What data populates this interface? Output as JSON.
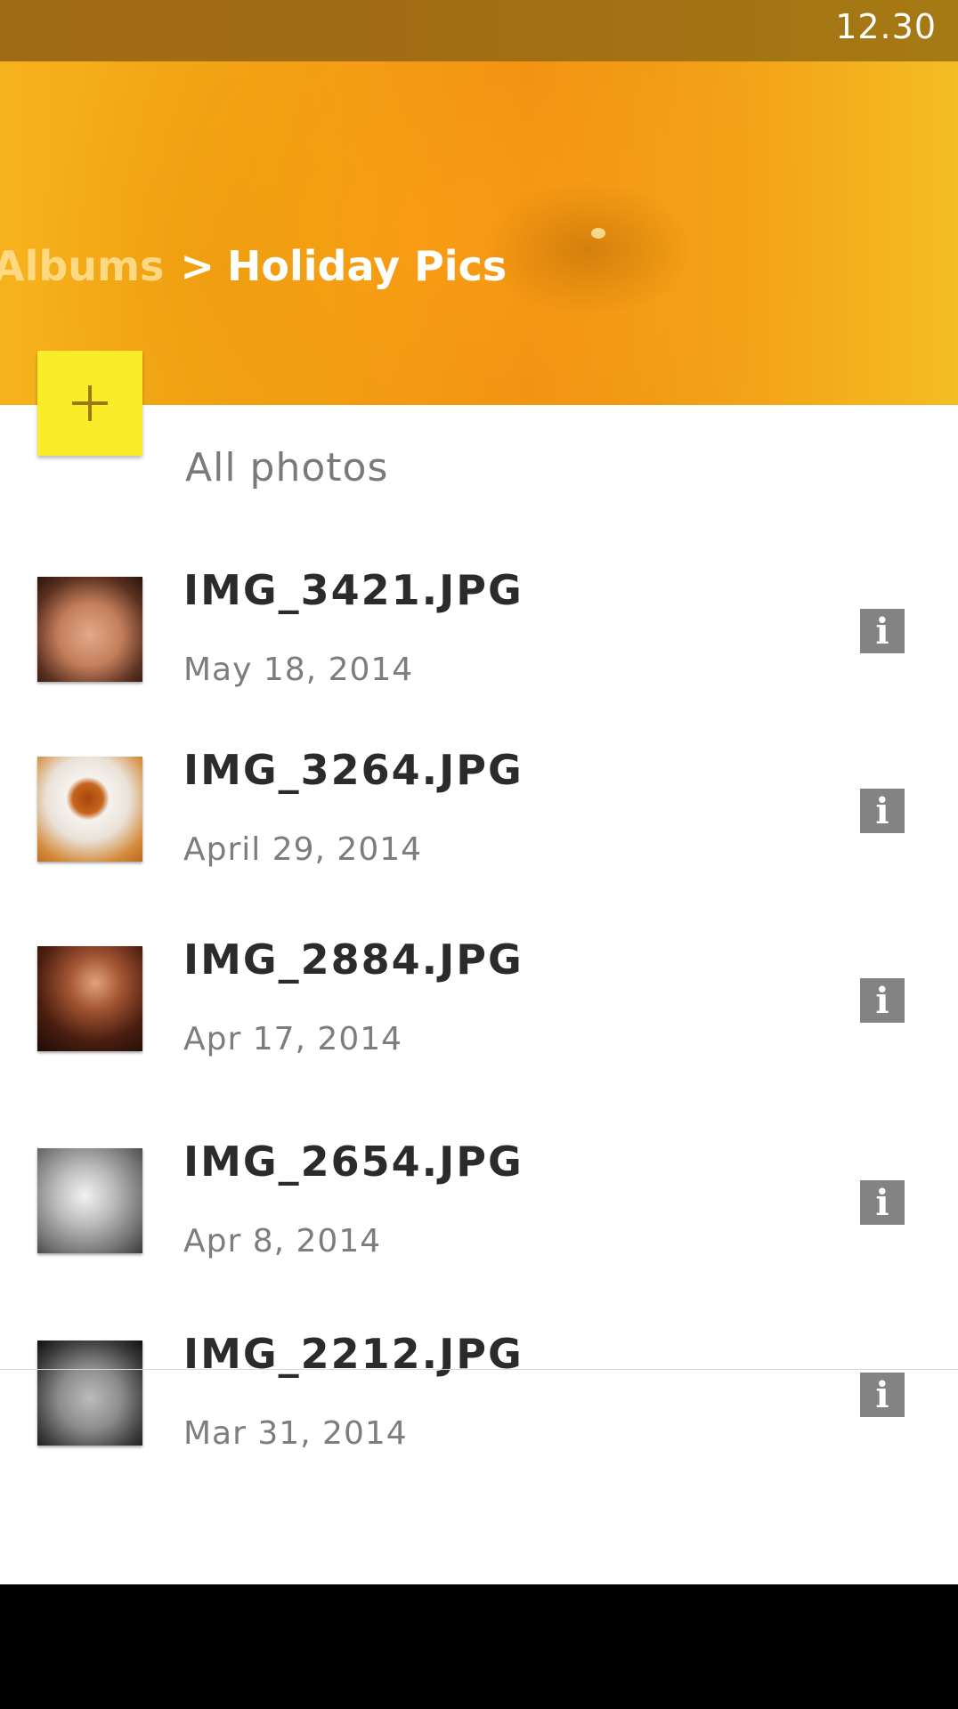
{
  "status_bar": {
    "time": "12.30"
  },
  "header": {
    "breadcrumb": {
      "parent": "Albums",
      "separator": ">",
      "current": "Holiday Pics"
    }
  },
  "fab": {
    "icon": "plus-icon",
    "color": "#fbec2a"
  },
  "section": {
    "title": "All photos"
  },
  "photos": [
    {
      "name": "IMG_3421.JPG",
      "date": "May 18, 2014",
      "info_icon": "info-icon"
    },
    {
      "name": "IMG_3264.JPG",
      "date": "April 29, 2014",
      "info_icon": "info-icon"
    },
    {
      "name": "IMG_2884.JPG",
      "date": "Apr 17, 2014",
      "info_icon": "info-icon"
    },
    {
      "name": "IMG_2654.JPG",
      "date": "Apr 8, 2014",
      "info_icon": "info-icon"
    },
    {
      "name": "IMG_2212.JPG",
      "date": "Mar 31, 2014",
      "info_icon": "info-icon"
    }
  ],
  "colors": {
    "accent": "#f3a114",
    "status_bar": "#a36d14",
    "fab": "#fbec2a",
    "info_icon": "#838383"
  }
}
